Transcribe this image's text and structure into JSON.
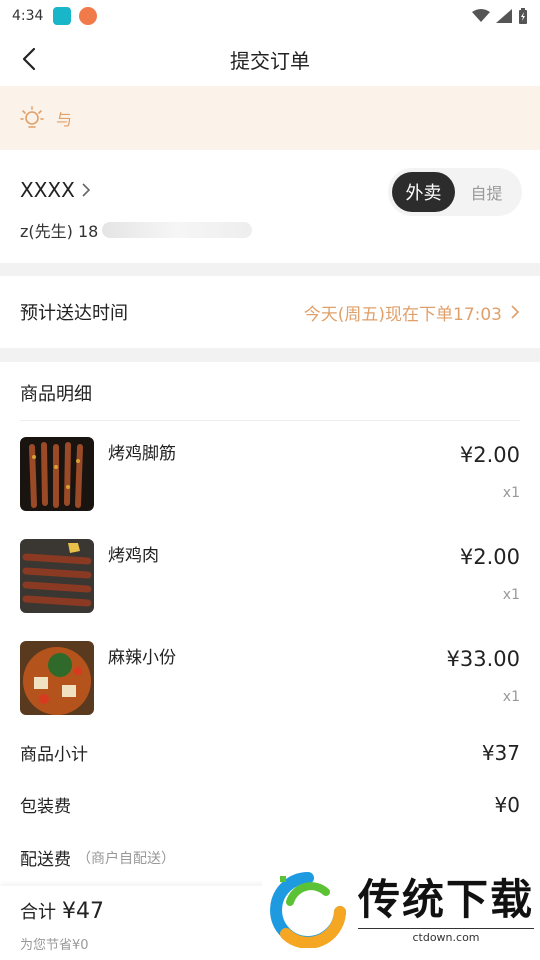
{
  "status_bar": {
    "time": "4:34"
  },
  "nav": {
    "title": "提交订单"
  },
  "notice": {
    "text": "与"
  },
  "address": {
    "name": "XXXX",
    "contact": "z(先生) 18",
    "modes": [
      {
        "label": "外卖",
        "active": true
      },
      {
        "label": "自提",
        "active": false
      }
    ]
  },
  "delivery": {
    "label": "预计送达时间",
    "value": "今天(周五)现在下单17:03"
  },
  "detail": {
    "title": "商品明细",
    "items": [
      {
        "name": "烤鸡脚筋",
        "price": "¥2.00",
        "qty": "x1",
        "image": "skewers-dark"
      },
      {
        "name": "烤鸡肉",
        "price": "¥2.00",
        "qty": "x1",
        "image": "skewers-grill"
      },
      {
        "name": "麻辣小份",
        "price": "¥33.00",
        "qty": "x1",
        "image": "spicy-pot"
      }
    ],
    "subtotal": {
      "label": "商品小计",
      "value": "¥37"
    },
    "packaging": {
      "label": "包装费",
      "value": "¥0"
    },
    "delivery_fee": {
      "label": "配送费",
      "note": "（商户自配送）"
    }
  },
  "bottom": {
    "total_label": "合计",
    "total": "¥47",
    "saved": "为您节省¥0"
  },
  "watermark": {
    "brand": "传统下载",
    "url": "ctdown.com"
  },
  "colors": {
    "accent": "#e0a06a",
    "notice_bg": "#fbf3ea",
    "toggle_active": "#2c2c2c"
  }
}
